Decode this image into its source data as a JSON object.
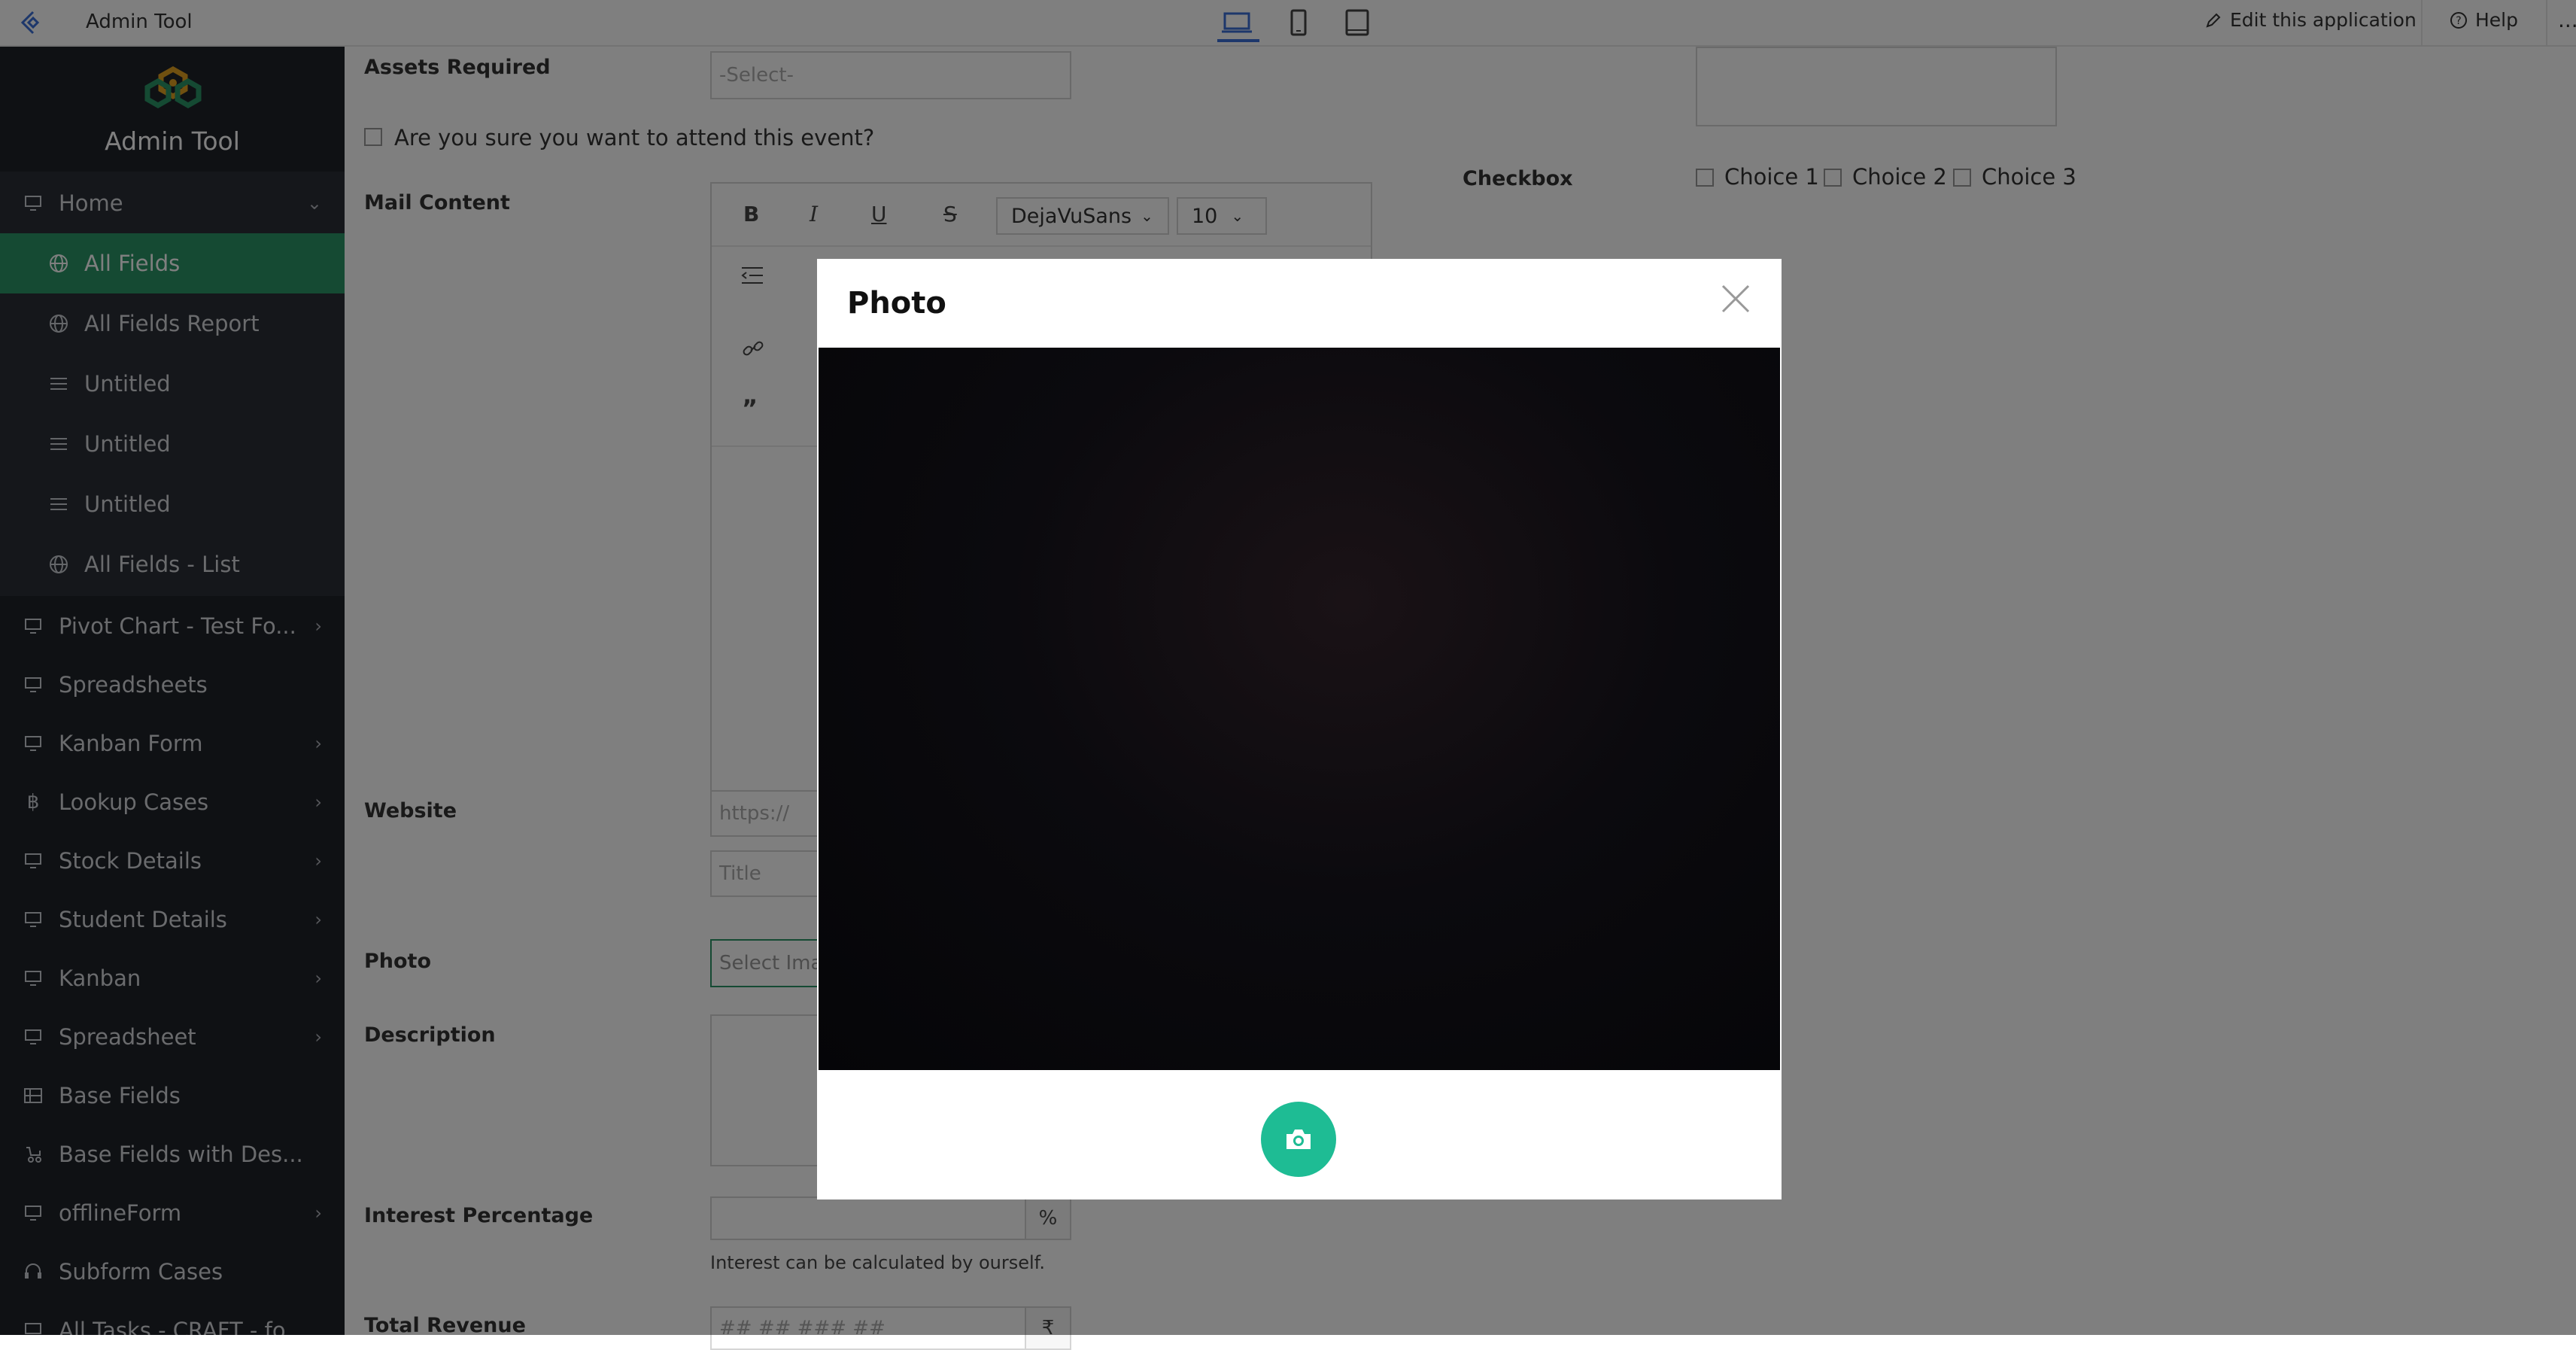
{
  "topbar": {
    "app_title": "Admin Tool",
    "edit_label": "Edit this application",
    "help_label": "Help",
    "more_label": "..."
  },
  "sidebar": {
    "brand_name": "Admin Tool",
    "items": [
      {
        "label": "Home",
        "icon": "monitor-icon",
        "chevron": "down"
      },
      {
        "label": "All Fields",
        "icon": "globe-icon",
        "active": true
      },
      {
        "label": "All Fields Report",
        "icon": "globe-icon"
      },
      {
        "label": "Untitled",
        "icon": "list-icon"
      },
      {
        "label": "Untitled",
        "icon": "list-icon"
      },
      {
        "label": "Untitled",
        "icon": "list-icon"
      },
      {
        "label": "All Fields - List",
        "icon": "globe-icon"
      },
      {
        "label": "Pivot Chart - Test Fo...",
        "icon": "monitor-icon",
        "chevron": "right"
      },
      {
        "label": "Spreadsheets",
        "icon": "monitor-icon"
      },
      {
        "label": "Kanban Form",
        "icon": "monitor-icon",
        "chevron": "right"
      },
      {
        "label": "Lookup Cases",
        "icon": "bitcoin-icon",
        "chevron": "right"
      },
      {
        "label": "Stock Details",
        "icon": "monitor-icon",
        "chevron": "right"
      },
      {
        "label": "Student Details",
        "icon": "monitor-icon",
        "chevron": "right"
      },
      {
        "label": "Kanban",
        "icon": "monitor-icon",
        "chevron": "right"
      },
      {
        "label": "Spreadsheet",
        "icon": "monitor-icon",
        "chevron": "right"
      },
      {
        "label": "Base Fields",
        "icon": "grid-icon"
      },
      {
        "label": "Base Fields with Des...",
        "icon": "stroller-icon"
      },
      {
        "label": "offlineForm",
        "icon": "monitor-icon",
        "chevron": "right"
      },
      {
        "label": "Subform Cases",
        "icon": "headset-icon"
      },
      {
        "label": "All Tasks - CRAFT - fo...",
        "icon": "monitor-icon"
      }
    ]
  },
  "form": {
    "assets_label": "Assets Required",
    "assets_placeholder": "-Select-",
    "attend_label": "Are you sure you want to attend this event?",
    "mail_label": "Mail Content",
    "font_name": "DejaVuSans",
    "font_size": "10",
    "checkbox_label": "Checkbox",
    "choices": [
      "Choice 1",
      "Choice 2",
      "Choice 3"
    ],
    "website_label": "Website",
    "website_placeholder": "https://",
    "title_placeholder": "Title",
    "photo_label": "Photo",
    "photo_placeholder": "Select Ima",
    "description_label": "Description",
    "interest_label": "Interest Percentage",
    "interest_suffix": "%",
    "interest_hint": "Interest can be calculated by ourself.",
    "revenue_label": "Total Revenue",
    "revenue_placeholder": "## ## ### ##",
    "revenue_suffix": "₹"
  },
  "modal": {
    "title": "Photo",
    "close_icon": "close-icon",
    "capture_icon": "camera-icon"
  },
  "colors": {
    "sidebar_bg": "#1f2229",
    "active_item": "#2b9466",
    "capture_button": "#1ebc94",
    "device_active": "#3b6fd6"
  }
}
